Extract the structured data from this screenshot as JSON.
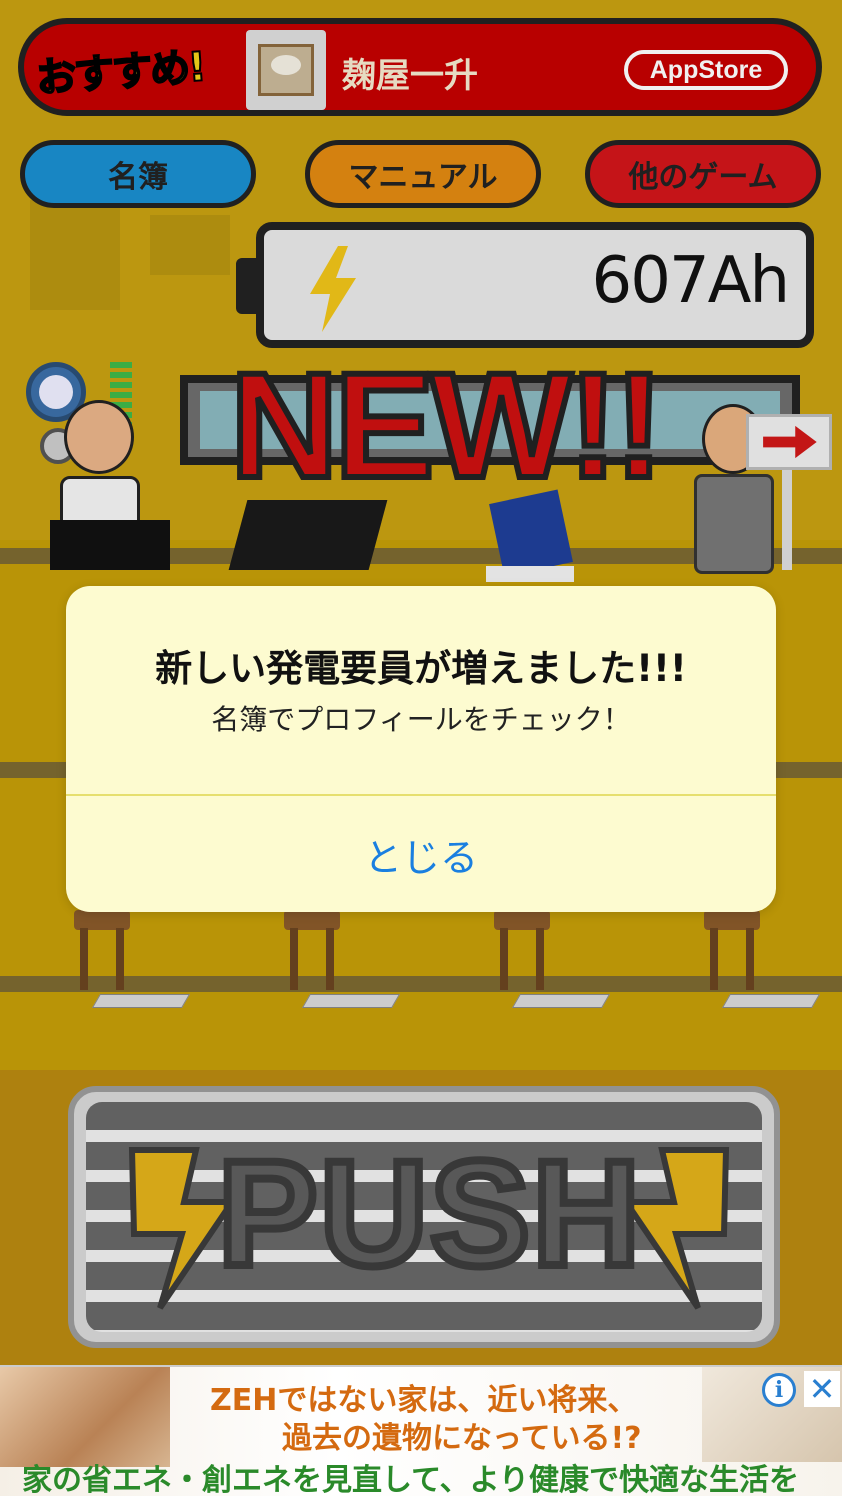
{
  "recommend": {
    "badge_label": "おすすめ!",
    "app_title": "麹屋一升",
    "appstore_label": "AppStore"
  },
  "menu": {
    "roster_label": "名簿",
    "manual_label": "マニュアル",
    "other_games_label": "他のゲーム"
  },
  "battery": {
    "value": "607Ah",
    "icon": "lightning-bolt-icon"
  },
  "banner": {
    "new_label": "NEW!!"
  },
  "dialog": {
    "title": "新しい発電要員が増えました!!!",
    "message": "名簿でプロフィールをチェック！",
    "close_label": "とじる"
  },
  "push": {
    "label": "PUSH",
    "icon": "lightning-bolt-icon"
  },
  "ad": {
    "line1": "ZEHではない家は、近い将来、",
    "line2": "過去の遺物になっている!?",
    "line3": "家の省エネ・創エネを見直して、より健康で快適な生活を",
    "info_icon": "i",
    "close_icon": "✕"
  },
  "colors": {
    "accent_red": "#c40000",
    "menu_blue": "#1a8fd0",
    "menu_orange": "#e28a12",
    "menu_red": "#d2161a",
    "dialog_bg": "#fdfbd0",
    "link_blue": "#1a7fe0"
  }
}
